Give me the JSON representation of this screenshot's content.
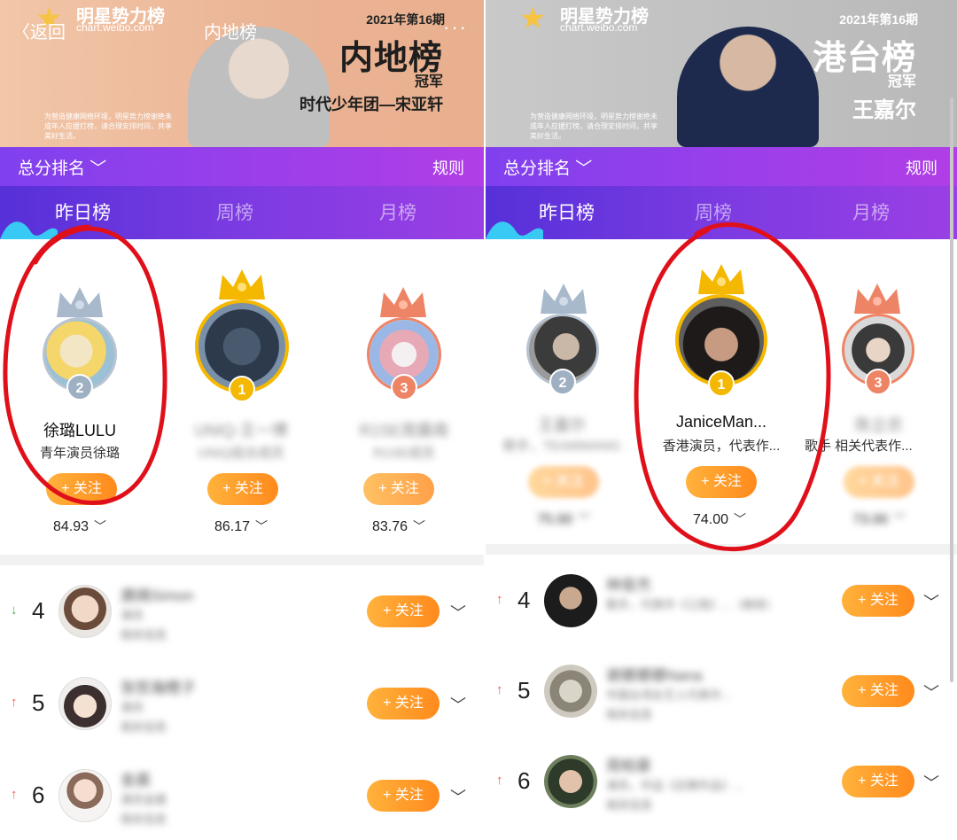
{
  "left": {
    "banner": {
      "logo_title": "明星势力榜",
      "logo_url": "chart.weibo.com",
      "back": "〈返回",
      "page_title": "内地榜",
      "more": "···",
      "issue": "2021年第16期",
      "board_name": "内地榜",
      "champion_label": "冠军",
      "champion_name": "时代少年团—宋亚轩",
      "notice": "为营造健康网络环境，明星势力榜谢绝未成年人应援打榜，请合理安排时间，共享美好生活。"
    },
    "sort_label": "总分排名",
    "rules": "规则",
    "tabs": [
      "昨日榜",
      "周榜",
      "月榜"
    ],
    "podium": [
      {
        "rank": "2",
        "name": "徐璐LULU",
        "desc": "青年演员徐璐",
        "follow": "+ 关注",
        "score": "84.93"
      },
      {
        "rank": "1",
        "name": "UNIQ-王一博",
        "desc": "UNIQ组合成员",
        "follow": "+ 关注",
        "score": "86.17"
      },
      {
        "rank": "3",
        "name": "R1SE周震南",
        "desc": "R1SE成员",
        "follow": "+ 关注",
        "score": "83.76"
      }
    ],
    "list": [
      {
        "rank": "4",
        "trend": "↓",
        "name": "唐嫣Simon",
        "sub1": "演员",
        "sub2": "相关信息",
        "follow": "+ 关注"
      },
      {
        "rank": "5",
        "trend": "↑",
        "name": "张哲瀚橙子",
        "sub1": "演员",
        "sub2": "相关信息",
        "follow": "+ 关注"
      },
      {
        "rank": "6",
        "trend": "↑",
        "name": "金晨",
        "sub1": "演员金晨",
        "sub2": "相关信息",
        "follow": "+ 关注"
      }
    ]
  },
  "right": {
    "banner": {
      "logo_title": "明星势力榜",
      "logo_url": "chart.weibo.com",
      "issue": "2021年第16期",
      "board_name": "港台榜",
      "champion_label": "冠军",
      "champion_name": "王嘉尔",
      "notice": "为营造健康网络环境，明星势力榜谢绝未成年人应援打榜，请合理安排时间，共享美好生活。"
    },
    "sort_label": "总分排名",
    "rules": "规则",
    "tabs": [
      "昨日榜",
      "周榜",
      "月榜"
    ],
    "podium": [
      {
        "rank": "2",
        "name": "王嘉尔",
        "desc": "歌手，TEAMWANG",
        "follow": "+ 关注",
        "score": "75.00"
      },
      {
        "rank": "1",
        "name": "JaniceMan...",
        "desc": "香港演员，代表作...",
        "follow": "+ 关注",
        "score": "74.00"
      },
      {
        "rank": "3",
        "name": "陈立农",
        "desc": "歌手 相关代表作...",
        "follow": "+ 关注",
        "score": "73.00"
      }
    ],
    "list": [
      {
        "rank": "4",
        "trend": "↑",
        "name": "林俊杰",
        "sub1": "歌手，代表作《江南》...（继续）",
        "sub2": "",
        "follow": "+ 关注"
      },
      {
        "rank": "5",
        "trend": "↑",
        "name": "谢娜娜娜Nana",
        "sub1": "中国台湾女艺人代表作...",
        "sub2": "相关信息",
        "follow": "+ 关注"
      },
      {
        "rank": "6",
        "trend": "↑",
        "name": "周柏豪",
        "sub1": "演员，作品《近期作品》...",
        "sub2": "相关信息",
        "follow": "+ 关注"
      }
    ]
  },
  "colors": {
    "accent_purple": "#8040ee",
    "follow_orange": "#ff9a24",
    "annotation_red": "#e0101a",
    "gold": "#f5b800",
    "silver": "#9fb0c3",
    "bronze": "#ee8466"
  },
  "icons": [
    "star-logo-icon",
    "chevron-down-icon",
    "crown-icon",
    "arrow-up-icon",
    "arrow-down-icon",
    "plus-icon"
  ]
}
